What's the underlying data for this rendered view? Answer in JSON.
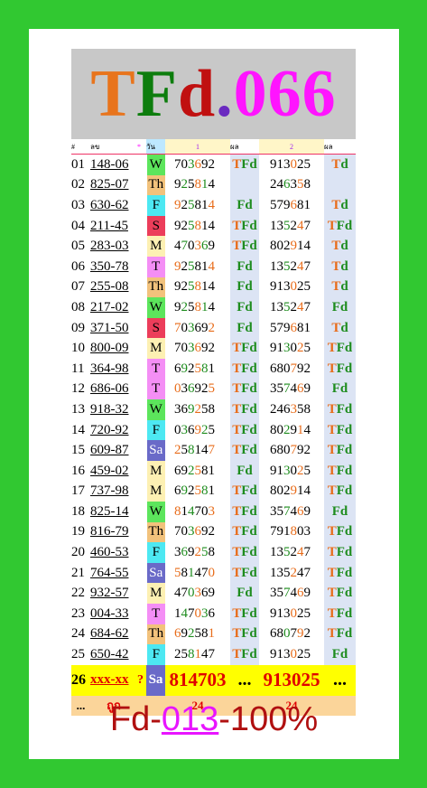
{
  "banner": {
    "title_parts": [
      {
        "text": "T",
        "color": "#e8741c"
      },
      {
        "text": "F",
        "color": "#0d7d0d"
      },
      {
        "text": "d",
        "color": "#c01010"
      },
      {
        "text": ".",
        "color": "#6a2ac0"
      },
      {
        "text": "066",
        "color": "#ff14ff"
      }
    ]
  },
  "header": {
    "idx": "#",
    "code": "ลข",
    "star": "*",
    "day": "วัน",
    "col1": "1",
    "m1": "ผล",
    "col2": "2",
    "m2": "ผล"
  },
  "rows": [
    {
      "idx": "01",
      "code": "148-06",
      "day": "W",
      "n1": "703692",
      "m1": "TFd",
      "n2": "913025",
      "m2": "Td"
    },
    {
      "idx": "02",
      "code": "825-07",
      "day": "Th",
      "n1": "925814",
      "m1": "",
      "n2": "246358",
      "m2": ""
    },
    {
      "idx": "03",
      "code": "630-62",
      "day": "F",
      "n1": "925814",
      "m1": "Fd",
      "n2": "579681",
      "m2": "Td"
    },
    {
      "idx": "04",
      "code": "211-45",
      "day": "S",
      "n1": "925814",
      "m1": "TFd",
      "n2": "135247",
      "m2": "TFd"
    },
    {
      "idx": "05",
      "code": "283-03",
      "day": "M",
      "n1": "470369",
      "m1": "TFd",
      "n2": "802914",
      "m2": "Td"
    },
    {
      "idx": "06",
      "code": "350-78",
      "day": "T",
      "n1": "925814",
      "m1": "Fd",
      "n2": "135247",
      "m2": "Td"
    },
    {
      "idx": "07",
      "code": "255-08",
      "day": "Th",
      "n1": "925814",
      "m1": "Fd",
      "n2": "913025",
      "m2": "Td"
    },
    {
      "idx": "08",
      "code": "217-02",
      "day": "W",
      "n1": "925814",
      "m1": "Fd",
      "n2": "135247",
      "m2": "Fd"
    },
    {
      "idx": "09",
      "code": "371-50",
      "day": "S",
      "n1": "703692",
      "m1": "Fd",
      "n2": "579681",
      "m2": "Td"
    },
    {
      "idx": "10",
      "code": "800-09",
      "day": "M",
      "n1": "703692",
      "m1": "TFd",
      "n2": "913025",
      "m2": "TFd"
    },
    {
      "idx": "11",
      "code": "364-98",
      "day": "T",
      "n1": "692581",
      "m1": "TFd",
      "n2": "680792",
      "m2": "TFd"
    },
    {
      "idx": "12",
      "code": "686-06",
      "day": "T",
      "n1": "036925",
      "m1": "TFd",
      "n2": "357469",
      "m2": "Fd"
    },
    {
      "idx": "13",
      "code": "918-32",
      "day": "W",
      "n1": "369258",
      "m1": "TFd",
      "n2": "246358",
      "m2": "TFd"
    },
    {
      "idx": "14",
      "code": "720-92",
      "day": "F",
      "n1": "036925",
      "m1": "TFd",
      "n2": "802914",
      "m2": "TFd"
    },
    {
      "idx": "15",
      "code": "609-87",
      "day": "Sa",
      "n1": "258147",
      "m1": "TFd",
      "n2": "680792",
      "m2": "TFd"
    },
    {
      "idx": "16",
      "code": "459-02",
      "day": "M",
      "n1": "692581",
      "m1": "Fd",
      "n2": "913025",
      "m2": "TFd"
    },
    {
      "idx": "17",
      "code": "737-98",
      "day": "M",
      "n1": "692581",
      "m1": "TFd",
      "n2": "802914",
      "m2": "TFd"
    },
    {
      "idx": "18",
      "code": "825-14",
      "day": "W",
      "n1": "814703",
      "m1": "TFd",
      "n2": "357469",
      "m2": "Fd"
    },
    {
      "idx": "19",
      "code": "816-79",
      "day": "Th",
      "n1": "703692",
      "m1": "TFd",
      "n2": "791803",
      "m2": "TFd"
    },
    {
      "idx": "20",
      "code": "460-53",
      "day": "F",
      "n1": "369258",
      "m1": "TFd",
      "n2": "135247",
      "m2": "TFd"
    },
    {
      "idx": "21",
      "code": "764-55",
      "day": "Sa",
      "n1": "581470",
      "m1": "TFd",
      "n2": "135247",
      "m2": "TFd"
    },
    {
      "idx": "22",
      "code": "932-57",
      "day": "M",
      "n1": "470369",
      "m1": "Fd",
      "n2": "357469",
      "m2": "TFd"
    },
    {
      "idx": "23",
      "code": "004-33",
      "day": "T",
      "n1": "147036",
      "m1": "TFd",
      "n2": "913025",
      "m2": "TFd"
    },
    {
      "idx": "24",
      "code": "684-62",
      "day": "Th",
      "n1": "692581",
      "m1": "TFd",
      "n2": "680792",
      "m2": "TFd"
    },
    {
      "idx": "25",
      "code": "650-42",
      "day": "F",
      "n1": "258147",
      "m1": "TFd",
      "n2": "913025",
      "m2": "Fd"
    }
  ],
  "final_row": {
    "idx": "26",
    "code": "xxx-xx",
    "q": "?",
    "day": "Sa",
    "n1": "814703",
    "m1": "...",
    "n2": "913025",
    "m2": "..."
  },
  "totals_row": {
    "a": "...",
    "b": "ถูก",
    "c": "24",
    "d": "24"
  },
  "footer": {
    "prefix": "Fd-",
    "middle": "013",
    "suffix": "-100%"
  },
  "colors": {
    "green_bg": "#31c831",
    "banner_gray": "#c8c8c8",
    "tfd_green": "#1e8c1e",
    "tfd_orange": "#e86c1a",
    "final_yellow": "#ffff00",
    "final_red": "#e00000"
  }
}
